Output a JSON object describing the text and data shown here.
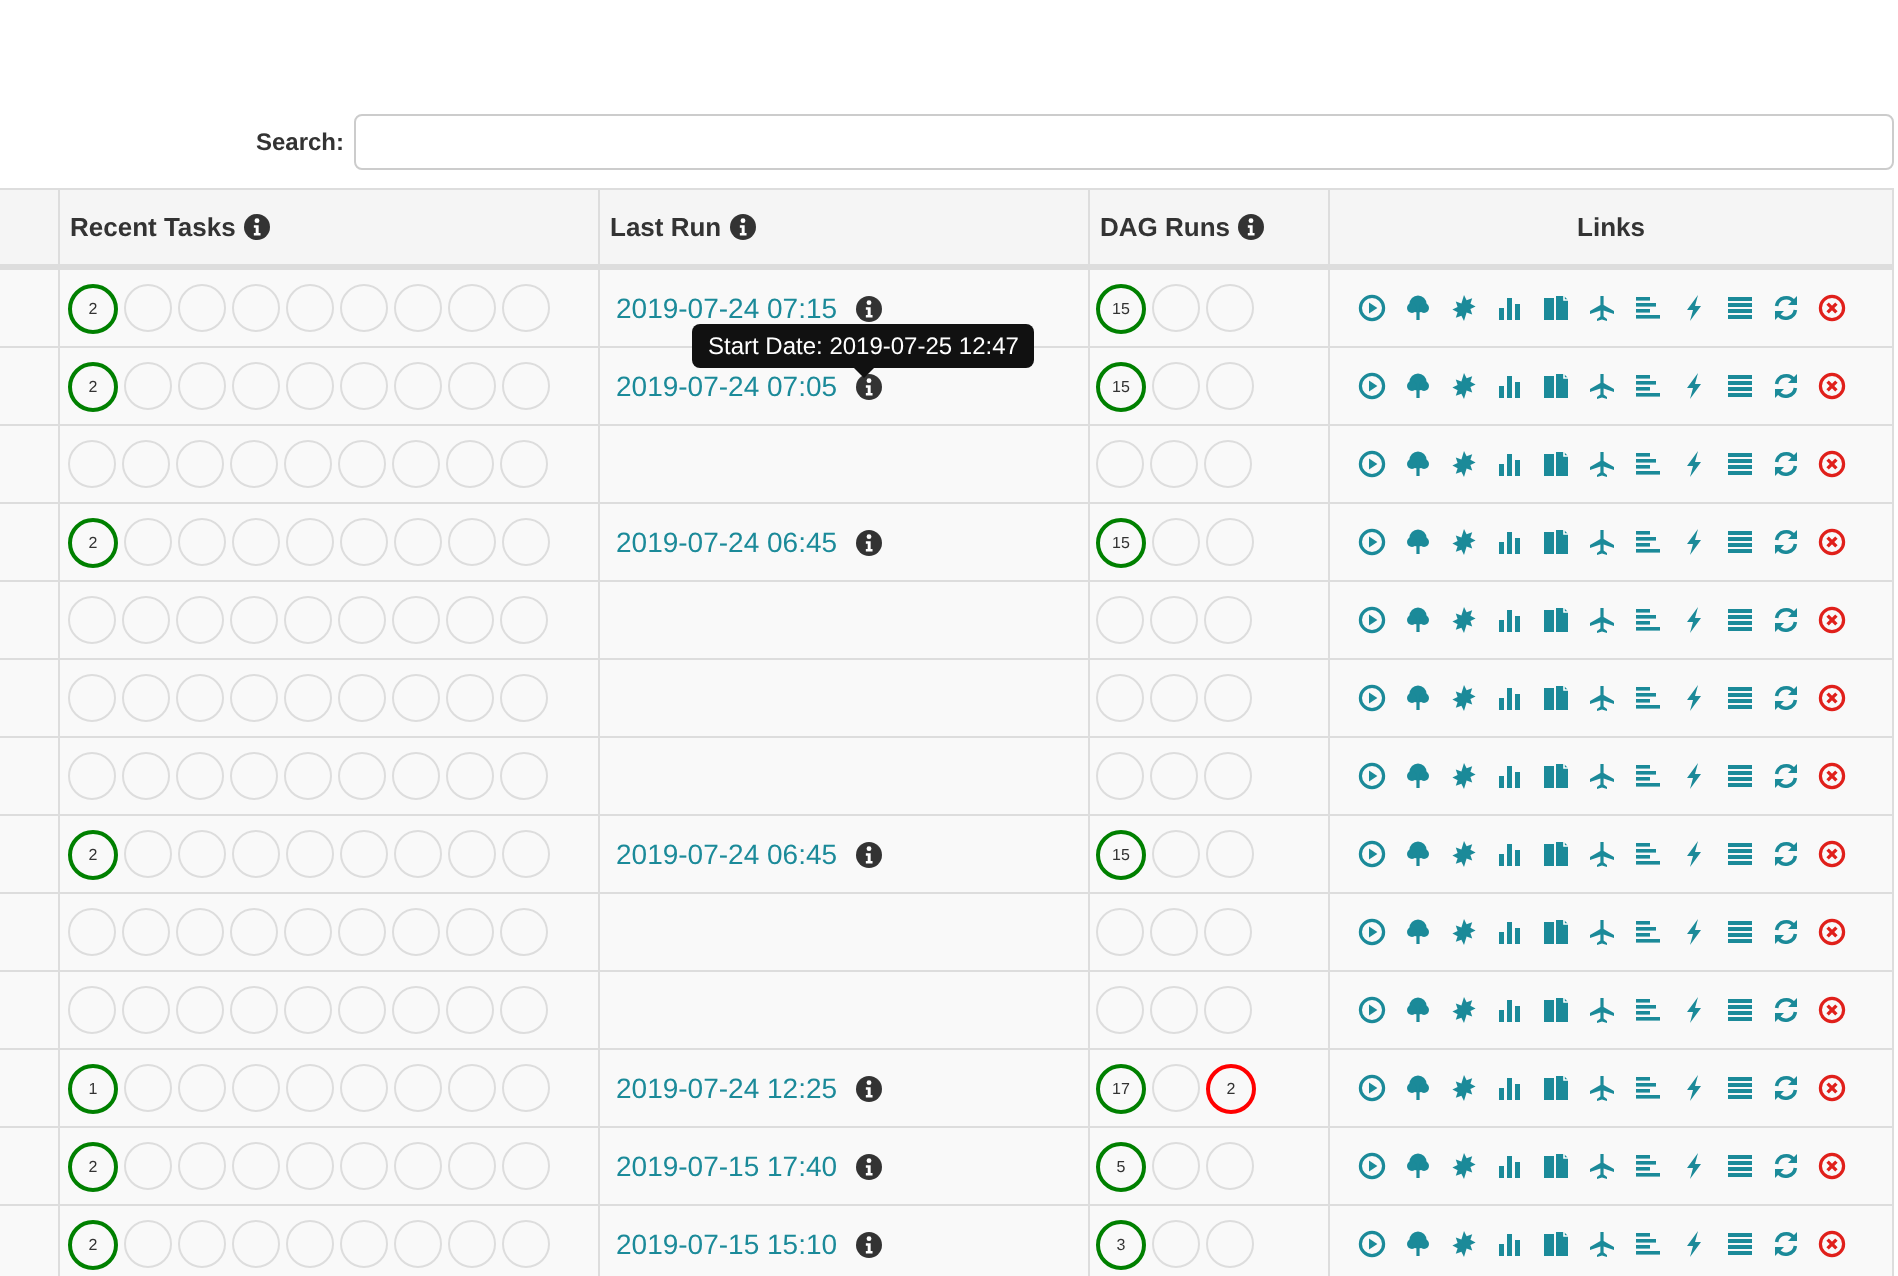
{
  "search": {
    "label": "Search:"
  },
  "table": {
    "columns": [
      {
        "label": "Recent Tasks",
        "info": true
      },
      {
        "label": "Last Run",
        "info": true
      },
      {
        "label": "DAG Runs",
        "info": true
      },
      {
        "label": "Links",
        "info": false
      }
    ],
    "rows": [
      {
        "recent_tasks": [
          {
            "count": "2",
            "color": "#008000"
          },
          {
            "color": "#dddddd"
          },
          {
            "color": "#dddddd"
          },
          {
            "color": "#dddddd"
          },
          {
            "color": "#dddddd"
          },
          {
            "color": "#dddddd"
          },
          {
            "color": "#dddddd"
          },
          {
            "color": "#dddddd"
          },
          {
            "color": "#dddddd"
          }
        ],
        "last_run": "2019-07-24 07:15",
        "dag_runs": [
          {
            "count": "15",
            "color": "#008000"
          },
          {
            "color": "#dddddd"
          },
          {
            "color": "#dddddd"
          }
        ]
      },
      {
        "recent_tasks": [
          {
            "count": "2",
            "color": "#008000"
          },
          {
            "color": "#dddddd"
          },
          {
            "color": "#dddddd"
          },
          {
            "color": "#dddddd"
          },
          {
            "color": "#dddddd"
          },
          {
            "color": "#dddddd"
          },
          {
            "color": "#dddddd"
          },
          {
            "color": "#dddddd"
          },
          {
            "color": "#dddddd"
          }
        ],
        "last_run": "2019-07-24 07:05",
        "dag_runs": [
          {
            "count": "15",
            "color": "#008000"
          },
          {
            "color": "#dddddd"
          },
          {
            "color": "#dddddd"
          }
        ],
        "tooltip": "Start Date: 2019-07-25 12:47"
      },
      {
        "recent_tasks": [
          {
            "color": "#dddddd"
          },
          {
            "color": "#dddddd"
          },
          {
            "color": "#dddddd"
          },
          {
            "color": "#dddddd"
          },
          {
            "color": "#dddddd"
          },
          {
            "color": "#dddddd"
          },
          {
            "color": "#dddddd"
          },
          {
            "color": "#dddddd"
          },
          {
            "color": "#dddddd"
          }
        ],
        "dag_runs": [
          {
            "color": "#dddddd"
          },
          {
            "color": "#dddddd"
          },
          {
            "color": "#dddddd"
          }
        ]
      },
      {
        "recent_tasks": [
          {
            "count": "2",
            "color": "#008000"
          },
          {
            "color": "#dddddd"
          },
          {
            "color": "#dddddd"
          },
          {
            "color": "#dddddd"
          },
          {
            "color": "#dddddd"
          },
          {
            "color": "#dddddd"
          },
          {
            "color": "#dddddd"
          },
          {
            "color": "#dddddd"
          },
          {
            "color": "#dddddd"
          }
        ],
        "last_run": "2019-07-24 06:45",
        "dag_runs": [
          {
            "count": "15",
            "color": "#008000"
          },
          {
            "color": "#dddddd"
          },
          {
            "color": "#dddddd"
          }
        ]
      },
      {
        "recent_tasks": [
          {
            "color": "#dddddd"
          },
          {
            "color": "#dddddd"
          },
          {
            "color": "#dddddd"
          },
          {
            "color": "#dddddd"
          },
          {
            "color": "#dddddd"
          },
          {
            "color": "#dddddd"
          },
          {
            "color": "#dddddd"
          },
          {
            "color": "#dddddd"
          },
          {
            "color": "#dddddd"
          }
        ],
        "dag_runs": [
          {
            "color": "#dddddd"
          },
          {
            "color": "#dddddd"
          },
          {
            "color": "#dddddd"
          }
        ]
      },
      {
        "recent_tasks": [
          {
            "color": "#dddddd"
          },
          {
            "color": "#dddddd"
          },
          {
            "color": "#dddddd"
          },
          {
            "color": "#dddddd"
          },
          {
            "color": "#dddddd"
          },
          {
            "color": "#dddddd"
          },
          {
            "color": "#dddddd"
          },
          {
            "color": "#dddddd"
          },
          {
            "color": "#dddddd"
          }
        ],
        "dag_runs": [
          {
            "color": "#dddddd"
          },
          {
            "color": "#dddddd"
          },
          {
            "color": "#dddddd"
          }
        ]
      },
      {
        "recent_tasks": [
          {
            "color": "#dddddd"
          },
          {
            "color": "#dddddd"
          },
          {
            "color": "#dddddd"
          },
          {
            "color": "#dddddd"
          },
          {
            "color": "#dddddd"
          },
          {
            "color": "#dddddd"
          },
          {
            "color": "#dddddd"
          },
          {
            "color": "#dddddd"
          },
          {
            "color": "#dddddd"
          }
        ],
        "dag_runs": [
          {
            "color": "#dddddd"
          },
          {
            "color": "#dddddd"
          },
          {
            "color": "#dddddd"
          }
        ]
      },
      {
        "recent_tasks": [
          {
            "count": "2",
            "color": "#008000"
          },
          {
            "color": "#dddddd"
          },
          {
            "color": "#dddddd"
          },
          {
            "color": "#dddddd"
          },
          {
            "color": "#dddddd"
          },
          {
            "color": "#dddddd"
          },
          {
            "color": "#dddddd"
          },
          {
            "color": "#dddddd"
          },
          {
            "color": "#dddddd"
          }
        ],
        "last_run": "2019-07-24 06:45",
        "dag_runs": [
          {
            "count": "15",
            "color": "#008000"
          },
          {
            "color": "#dddddd"
          },
          {
            "color": "#dddddd"
          }
        ]
      },
      {
        "recent_tasks": [
          {
            "color": "#dddddd"
          },
          {
            "color": "#dddddd"
          },
          {
            "color": "#dddddd"
          },
          {
            "color": "#dddddd"
          },
          {
            "color": "#dddddd"
          },
          {
            "color": "#dddddd"
          },
          {
            "color": "#dddddd"
          },
          {
            "color": "#dddddd"
          },
          {
            "color": "#dddddd"
          }
        ],
        "dag_runs": [
          {
            "color": "#dddddd"
          },
          {
            "color": "#dddddd"
          },
          {
            "color": "#dddddd"
          }
        ]
      },
      {
        "recent_tasks": [
          {
            "color": "#dddddd"
          },
          {
            "color": "#dddddd"
          },
          {
            "color": "#dddddd"
          },
          {
            "color": "#dddddd"
          },
          {
            "color": "#dddddd"
          },
          {
            "color": "#dddddd"
          },
          {
            "color": "#dddddd"
          },
          {
            "color": "#dddddd"
          },
          {
            "color": "#dddddd"
          }
        ],
        "dag_runs": [
          {
            "color": "#dddddd"
          },
          {
            "color": "#dddddd"
          },
          {
            "color": "#dddddd"
          }
        ]
      },
      {
        "recent_tasks": [
          {
            "count": "1",
            "color": "#008000"
          },
          {
            "color": "#dddddd"
          },
          {
            "color": "#dddddd"
          },
          {
            "color": "#dddddd"
          },
          {
            "color": "#dddddd"
          },
          {
            "color": "#dddddd"
          },
          {
            "color": "#dddddd"
          },
          {
            "color": "#dddddd"
          },
          {
            "color": "#dddddd"
          }
        ],
        "last_run": "2019-07-24 12:25",
        "dag_runs": [
          {
            "count": "17",
            "color": "#008000"
          },
          {
            "color": "#dddddd"
          },
          {
            "count": "2",
            "color": "#ff0000"
          }
        ]
      },
      {
        "recent_tasks": [
          {
            "count": "2",
            "color": "#008000"
          },
          {
            "color": "#dddddd"
          },
          {
            "color": "#dddddd"
          },
          {
            "color": "#dddddd"
          },
          {
            "color": "#dddddd"
          },
          {
            "color": "#dddddd"
          },
          {
            "color": "#dddddd"
          },
          {
            "color": "#dddddd"
          },
          {
            "color": "#dddddd"
          }
        ],
        "last_run": "2019-07-15 17:40",
        "dag_runs": [
          {
            "count": "5",
            "color": "#008000"
          },
          {
            "color": "#dddddd"
          },
          {
            "color": "#dddddd"
          }
        ]
      },
      {
        "recent_tasks": [
          {
            "count": "2",
            "color": "#008000"
          },
          {
            "color": "#dddddd"
          },
          {
            "color": "#dddddd"
          },
          {
            "color": "#dddddd"
          },
          {
            "color": "#dddddd"
          },
          {
            "color": "#dddddd"
          },
          {
            "color": "#dddddd"
          },
          {
            "color": "#dddddd"
          },
          {
            "color": "#dddddd"
          }
        ],
        "last_run": "2019-07-15 15:10",
        "dag_runs": [
          {
            "count": "3",
            "color": "#008000"
          },
          {
            "color": "#dddddd"
          },
          {
            "color": "#dddddd"
          }
        ]
      }
    ]
  }
}
